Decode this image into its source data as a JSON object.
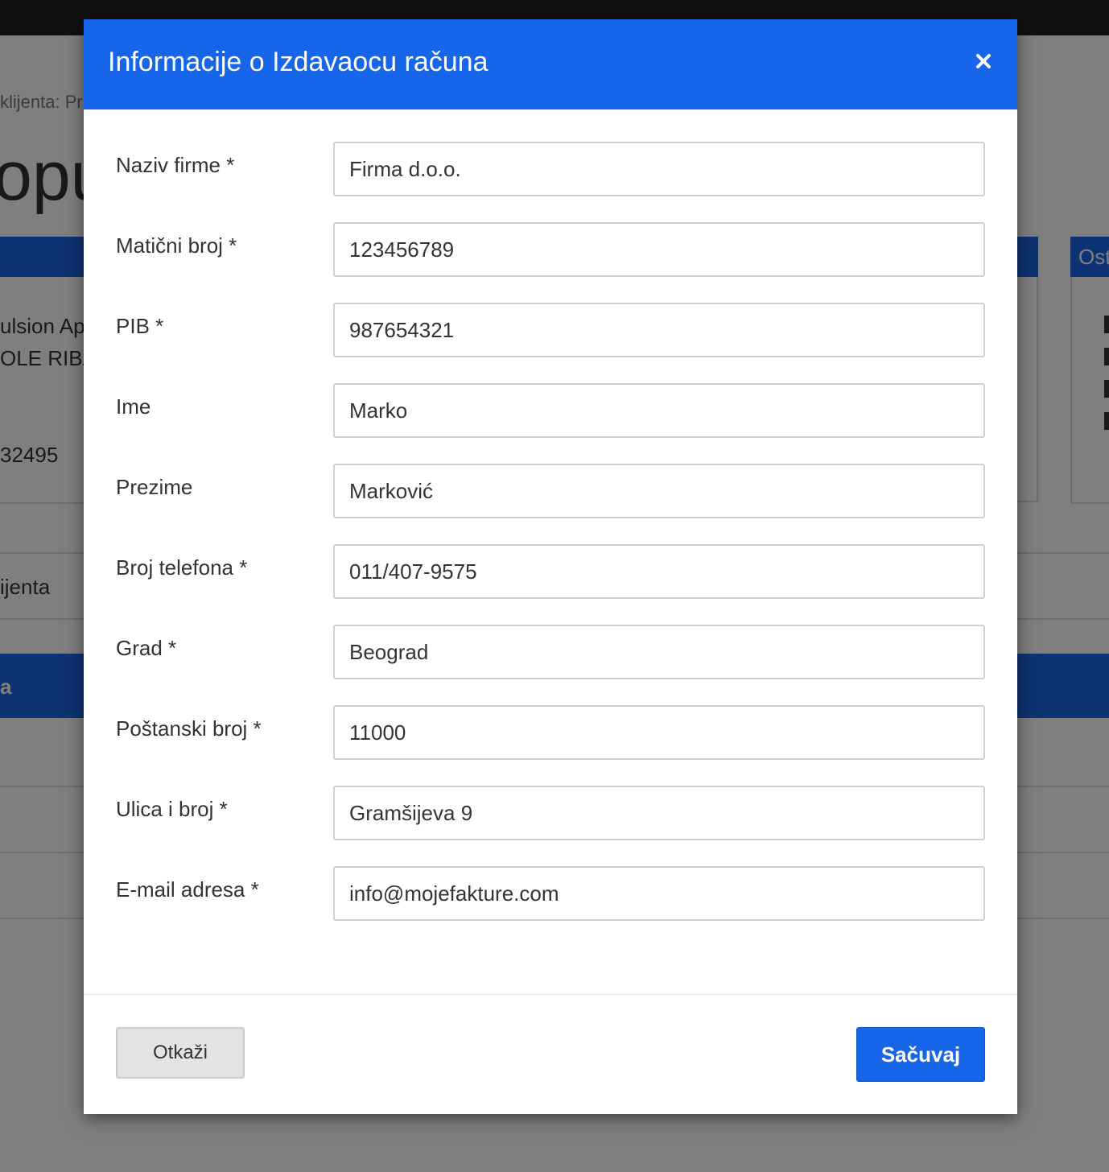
{
  "background": {
    "breadcrumb": "klijenta: Pr",
    "heading": "opu",
    "client_name": "ulsion Ap",
    "client_contact": "OLE RIBAI",
    "client_number": "32495",
    "right_panel_title": "Ost",
    "tab_label": "ijenta",
    "bar_label": "a"
  },
  "modal": {
    "title": "Informacije o Izdavaocu računa",
    "close_icon": "close-icon",
    "fields": [
      {
        "label": "Naziv firme *",
        "value": "Firma d.o.o."
      },
      {
        "label": "Matični broj *",
        "value": "123456789"
      },
      {
        "label": "PIB *",
        "value": "987654321"
      },
      {
        "label": "Ime",
        "value": "Marko"
      },
      {
        "label": "Prezime",
        "value": "Marković"
      },
      {
        "label": "Broj telefona *",
        "value": "011/407-9575"
      },
      {
        "label": "Grad *",
        "value": "Beograd"
      },
      {
        "label": "Poštanski broj *",
        "value": "11000"
      },
      {
        "label": "Ulica i broj *",
        "value": "Gramšijeva 9"
      },
      {
        "label": "E-mail adresa *",
        "value": "info@mojefakture.com"
      }
    ],
    "cancel_label": "Otkaži",
    "save_label": "Sačuvaj"
  },
  "colors": {
    "primary": "#1765e9",
    "overlay": "rgba(0,0,0,0.5)",
    "input_border": "#cfcfcf"
  }
}
